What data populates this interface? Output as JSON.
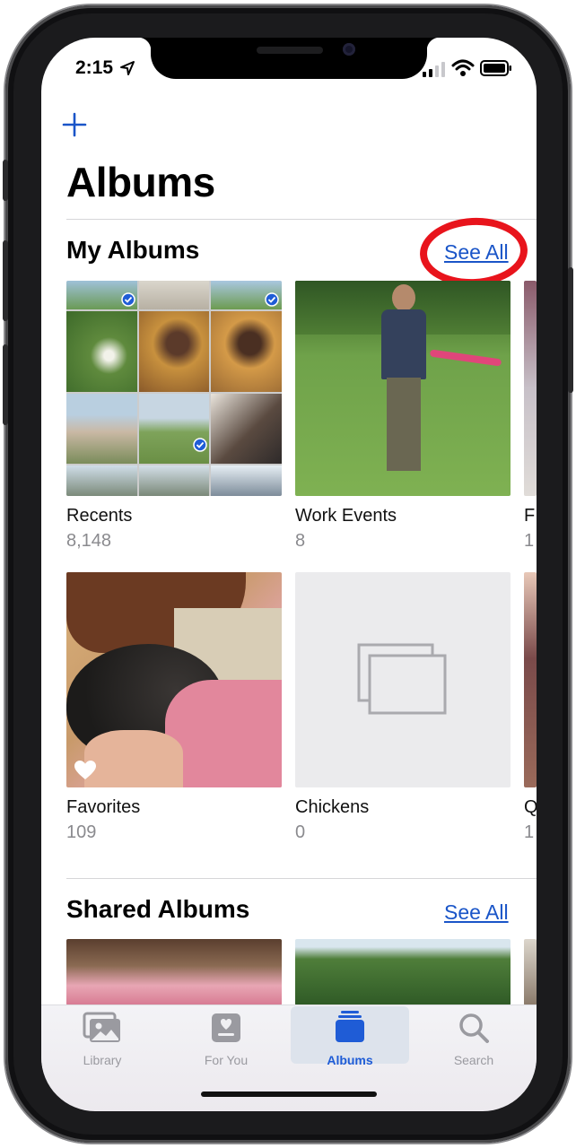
{
  "status_bar": {
    "time": "2:15"
  },
  "header": {
    "add_label": "+",
    "title": "Albums"
  },
  "my_albums": {
    "heading": "My Albums",
    "see_all": "See All",
    "albums": [
      {
        "name": "Recents",
        "count": "8,148"
      },
      {
        "name": "Work Events",
        "count": "8"
      },
      {
        "name": "F",
        "count": "1"
      },
      {
        "name": "Favorites",
        "count": "109"
      },
      {
        "name": "Chickens",
        "count": "0"
      },
      {
        "name": "Q",
        "count": "1"
      }
    ]
  },
  "shared_albums": {
    "heading": "Shared Albums",
    "see_all": "See All"
  },
  "tab_bar": {
    "items": [
      {
        "label": "Library",
        "icon": "photo-library-icon",
        "active": false
      },
      {
        "label": "For You",
        "icon": "for-you-icon",
        "active": false
      },
      {
        "label": "Albums",
        "icon": "albums-icon",
        "active": true
      },
      {
        "label": "Search",
        "icon": "search-icon",
        "active": false
      }
    ]
  },
  "colors": {
    "accent": "#1a55c8",
    "highlight_circle": "#e8141c",
    "muted_text": "#8a8a8e"
  }
}
